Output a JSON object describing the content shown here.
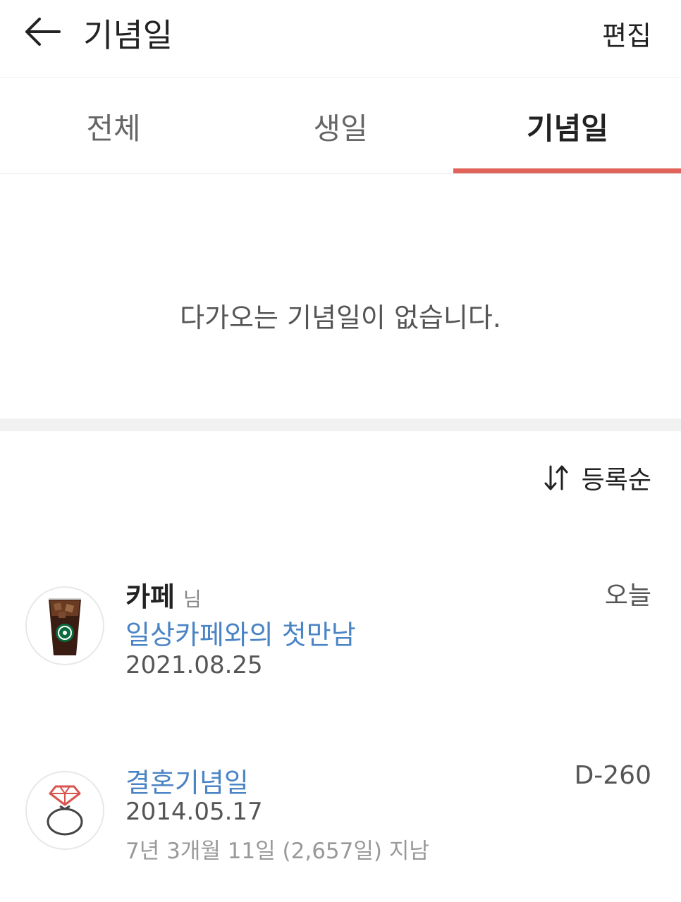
{
  "header": {
    "title": "기념일",
    "edit_label": "편집"
  },
  "tabs": [
    {
      "label": "전체",
      "active": false
    },
    {
      "label": "생일",
      "active": false
    },
    {
      "label": "기념일",
      "active": true
    }
  ],
  "accent_color": "#e06359",
  "empty_message": "다가오는 기념일이 없습니다.",
  "sort": {
    "label": "등록순",
    "icon": "sort-arrows-icon"
  },
  "anniversaries": [
    {
      "name": "카페",
      "suffix": "님",
      "title": "일상카페와의 첫만남",
      "date": "2021.08.25",
      "dday": "오늘",
      "icon": "iced-coffee-icon"
    },
    {
      "title": "결혼기념일",
      "date": "2014.05.17",
      "elapsed": "7년 3개월 11일 (2,657일) 지남",
      "dday": "D-260",
      "icon": "ring-icon"
    }
  ]
}
